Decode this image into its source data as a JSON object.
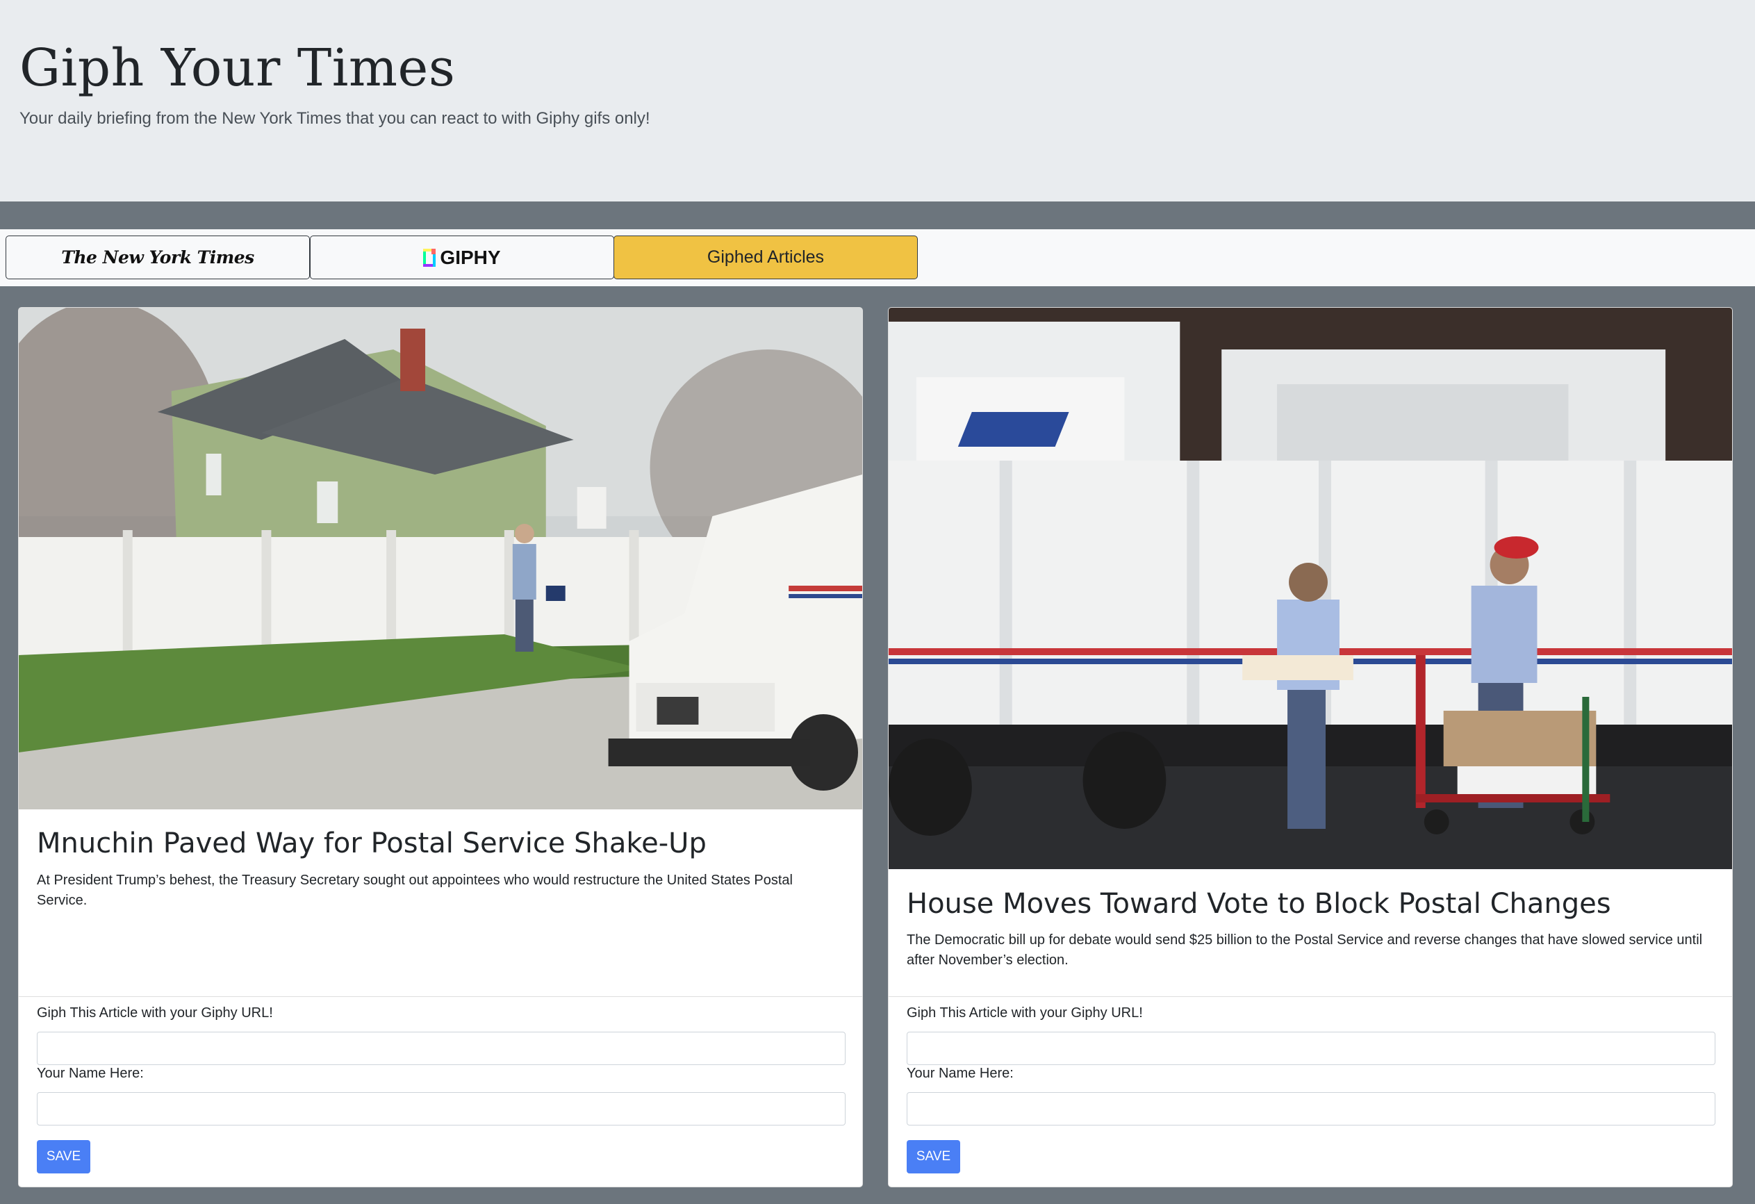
{
  "header": {
    "title": "Giph Your Times",
    "subtitle": "Your daily briefing from the New York Times that you can react to with Giphy gifs only!"
  },
  "nav": {
    "nyt_label": "The New York Times",
    "giphy_label": "GIPHY",
    "giphed_label": "Giphed Articles",
    "active_color": "#f0c243"
  },
  "articles": [
    {
      "title": "Mnuchin Paved Way for Postal Service Shake-Up",
      "abstract": "At President Trump’s behest, the Treasury Secretary sought out appointees who would restructure the United States Postal Service.",
      "image_desc": "mail carrier walking past a green house and white fence with a postal truck",
      "giph_label": "Giph This Article with your Giphy URL!",
      "giph_value": "",
      "name_label": "Your Name Here:",
      "name_value": "",
      "save_label": "SAVE"
    },
    {
      "title": "House Moves Toward Vote to Block Postal Changes",
      "abstract": "The Democratic bill up for debate would send $25 billion to the Postal Service and reverse changes that have slowed service until after November’s election.",
      "image_desc": "postal workers loading mail into a row of white USPS trucks",
      "giph_label": "Giph This Article with your Giphy URL!",
      "giph_value": "",
      "name_label": "Your Name Here:",
      "name_value": "",
      "save_label": "SAVE"
    }
  ],
  "colors": {
    "page_bg": "#6c757d",
    "jumbotron_bg": "#e9ecef",
    "save_button": "#4a7ff5"
  }
}
